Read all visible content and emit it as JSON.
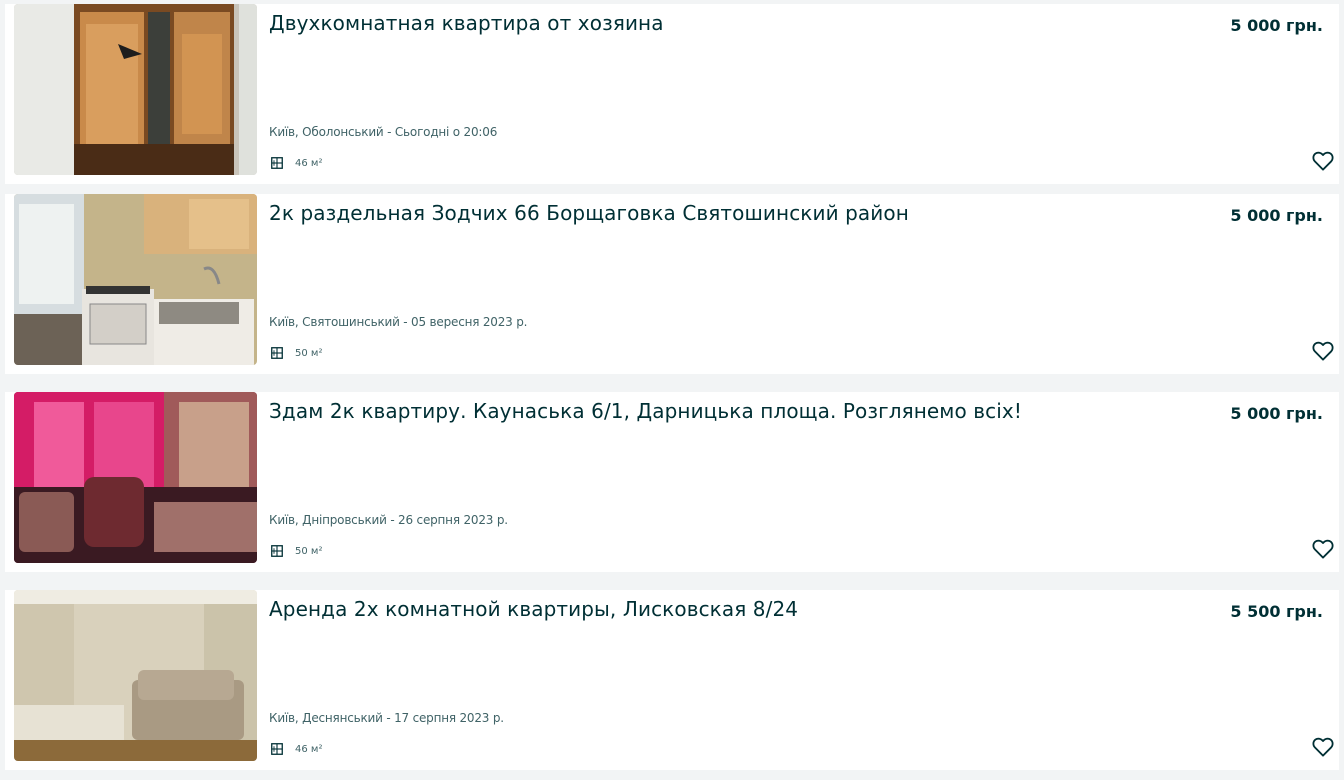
{
  "listings": [
    {
      "title": "Двухкомнатная квартира от хозяина",
      "price": "5 000 грн.",
      "location_date": "Київ, Оболонський - Сьогодні о 20:06",
      "area": "46 м²",
      "photo": "wardrobe-with-mirror-photo"
    },
    {
      "title": "2к раздельная Зодчих 66 Борщаговка Святошинский район",
      "price": "5 000 грн.",
      "location_date": "Київ, Святошинський - 05 вересня 2023 р.",
      "area": "50 м²",
      "photo": "kitchen-with-stove-photo"
    },
    {
      "title": "Здам 2к квартиру. Каунаська 6/1, Дарницька площа. Розглянемо всіх!",
      "price": "5 000 грн.",
      "location_date": "Київ, Дніпровський - 26 серпня 2023 р.",
      "area": "50 м²",
      "photo": "room-with-pink-curtains-photo"
    },
    {
      "title": "Аренда 2х комнатной квартиры, Лисковская 8/24",
      "price": "5 500 грн.",
      "location_date": "Київ, Деснянський - 17 серпня 2023 р.",
      "area": "46 м²",
      "photo": "room-with-sofa-photo"
    }
  ],
  "icons": {
    "area": "floor-plan-icon",
    "favorite": "heart-outline-icon"
  },
  "colors": {
    "text_primary": "#002f34",
    "text_secondary": "#406367",
    "card_background": "#ffffff",
    "page_background": "#f2f4f5"
  }
}
